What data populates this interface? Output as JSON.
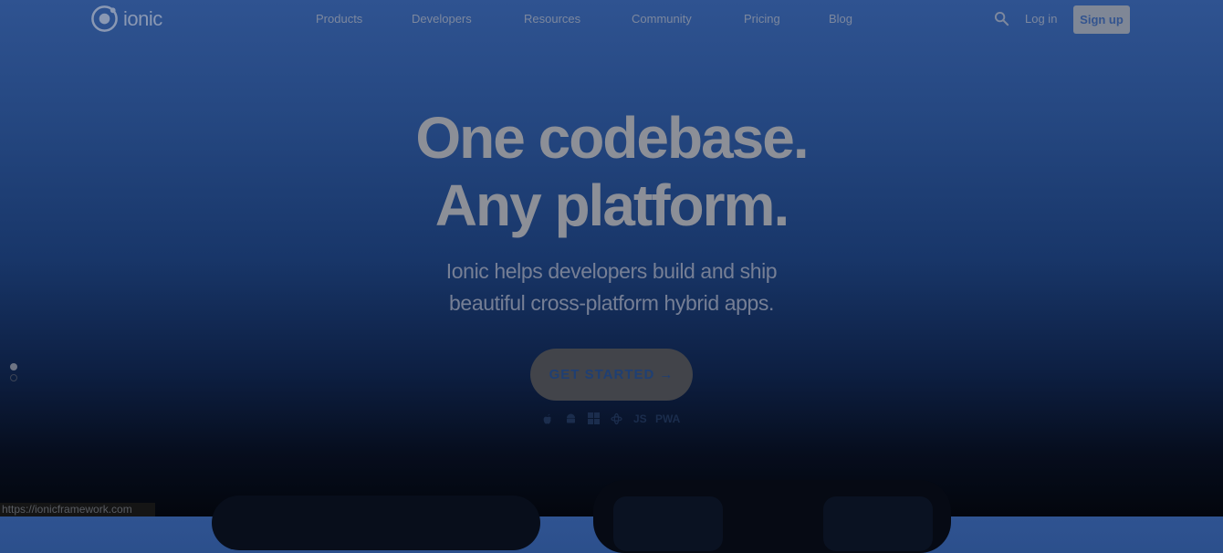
{
  "nav": {
    "logo_text": "ionic",
    "links": [
      "Products",
      "Developers",
      "Resources",
      "Community",
      "Pricing",
      "Blog"
    ],
    "login": "Log in",
    "signup": "Sign up"
  },
  "hero": {
    "title_line1": "One codebase.",
    "title_line2": "Any platform.",
    "subtitle_line1": "Ionic helps developers build and ship",
    "subtitle_line2": "beautiful cross-platform hybrid apps.",
    "cta": "GET STARTED",
    "cta_arrow": "→",
    "platforms": [
      "apple-icon",
      "android-icon",
      "windows-icon",
      "electron-icon",
      "JS",
      "PWA"
    ]
  },
  "status_bar_url": "https://ionicframework.com",
  "colors": {
    "bg_top": "#2f5391",
    "bg_bottom": "#03060d",
    "signup_bg": "#7f8796"
  }
}
